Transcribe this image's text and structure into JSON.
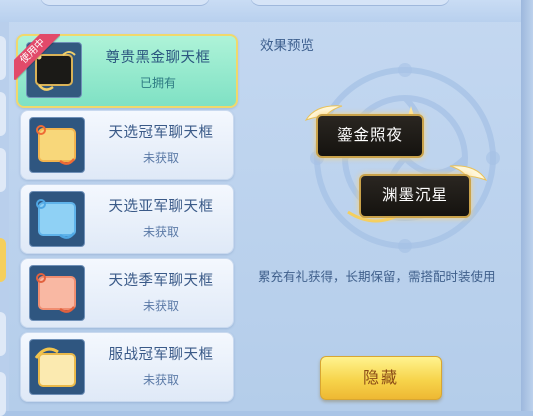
{
  "list": {
    "items": [
      {
        "name": "尊贵黑金聊天框",
        "status": "已拥有",
        "badge": "使用中",
        "selected": true
      },
      {
        "name": "天选冠军聊天框",
        "status": "未获取"
      },
      {
        "name": "天选亚军聊天框",
        "status": "未获取"
      },
      {
        "name": "天选季军聊天框",
        "status": "未获取"
      },
      {
        "name": "服战冠军聊天框",
        "status": "未获取"
      }
    ]
  },
  "preview": {
    "title": "效果预览",
    "bubble_1": "鎏金照夜",
    "bubble_2": "渊墨沉星",
    "description": "累充有礼获得，长期保留，需搭配时装使用"
  },
  "actions": {
    "hide_label": "隐藏"
  },
  "colors": {
    "selected_bg": "#7fe1c4",
    "badge": "#e24a6a",
    "button": "#f7d44b",
    "bubble_border": "#c9a24a"
  }
}
